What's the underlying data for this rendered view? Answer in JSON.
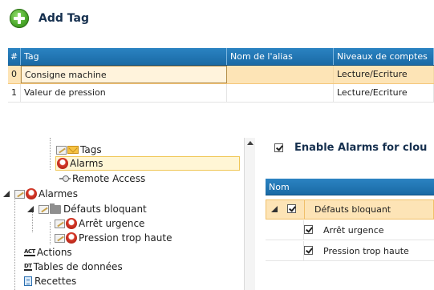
{
  "add_tag": {
    "label": "Add Tag",
    "icon": "plus-circle-icon",
    "color": "#4aa82a"
  },
  "tag_grid": {
    "columns": [
      "#",
      "Tag",
      "Nom de l'alias",
      "Niveaux de comptes"
    ],
    "rows": [
      {
        "num": "0",
        "tag": "Consigne machine",
        "alias": "",
        "level": "Lecture/Ecriture"
      },
      {
        "num": "1",
        "tag": "Valeur de pression",
        "alias": "",
        "level": "Lecture/Ecriture"
      }
    ],
    "header_color": "#1f78b8",
    "selected_color": "#fde4b6"
  },
  "tree": {
    "items": [
      {
        "label": "Tags"
      },
      {
        "label": "Alarms"
      },
      {
        "label": "Remote Access"
      },
      {
        "label": "Alarmes"
      },
      {
        "label": "Défauts bloquant"
      },
      {
        "label": "Arrêt urgence"
      },
      {
        "label": "Pression trop haute"
      },
      {
        "label": "Actions",
        "icon_text": "ACT"
      },
      {
        "label": "Tables de données",
        "icon_text": "DT"
      },
      {
        "label": "Recettes"
      }
    ]
  },
  "alarms_panel": {
    "enable_label": "Enable Alarms for clou",
    "enable_checked": true,
    "column_header": "Nom",
    "group": {
      "label": "Défauts bloquant",
      "checked": true
    },
    "items": [
      {
        "label": "Arrêt urgence",
        "checked": true
      },
      {
        "label": "Pression trop haute",
        "checked": true
      }
    ]
  }
}
